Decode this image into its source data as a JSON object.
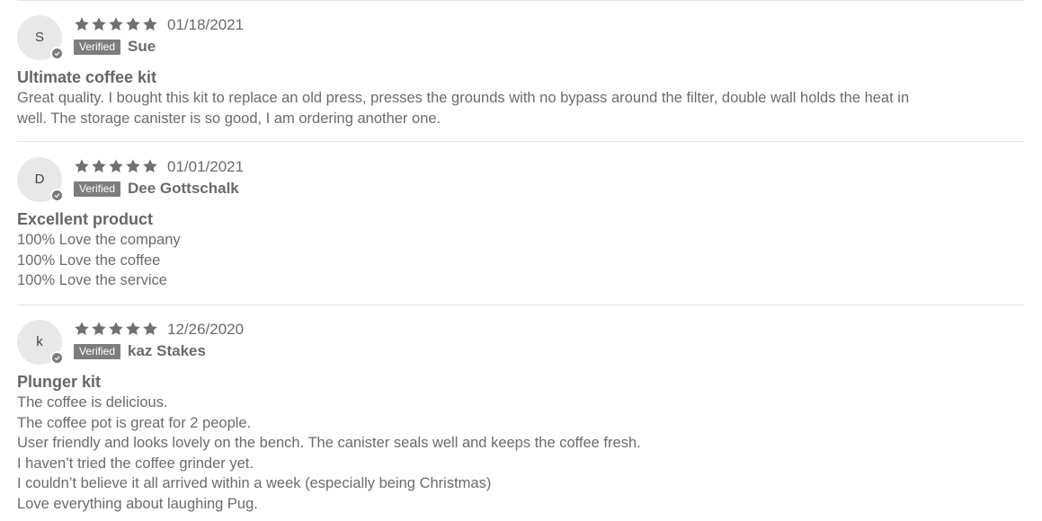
{
  "badge_label": "Verified",
  "colors": {
    "star": "#707070",
    "badge_bg": "#7d7d7d",
    "avatar_bg": "#e8e8e8",
    "check_bg": "#7a7a7a",
    "text": "#666666"
  },
  "reviews": [
    {
      "initial": "S",
      "rating": 5,
      "date": "01/18/2021",
      "author": "Sue",
      "title": "Ultimate coffee kit",
      "body_lines": [
        "Great quality. I bought this kit to replace an old press, presses the grounds with no bypass around the filter, double wall holds the heat in",
        "well. The storage canister is so good, I am ordering another one."
      ]
    },
    {
      "initial": "D",
      "rating": 5,
      "date": "01/01/2021",
      "author": "Dee Gottschalk",
      "title": "Excellent product",
      "body_lines": [
        "100% Love the company",
        "100% Love the coffee",
        "100% Love the service"
      ]
    },
    {
      "initial": "k",
      "rating": 5,
      "date": "12/26/2020",
      "author": "kaz Stakes",
      "title": "Plunger kit",
      "body_lines": [
        "The coffee is delicious.",
        "The coffee pot is great for 2 people.",
        "User friendly and looks lovely on the bench. The canister seals well and keeps the coffee fresh.",
        "I haven’t tried the coffee grinder yet.",
        "I couldn’t believe it all arrived within a week (especially being Christmas)",
        "Love everything about laughing Pug."
      ]
    }
  ]
}
